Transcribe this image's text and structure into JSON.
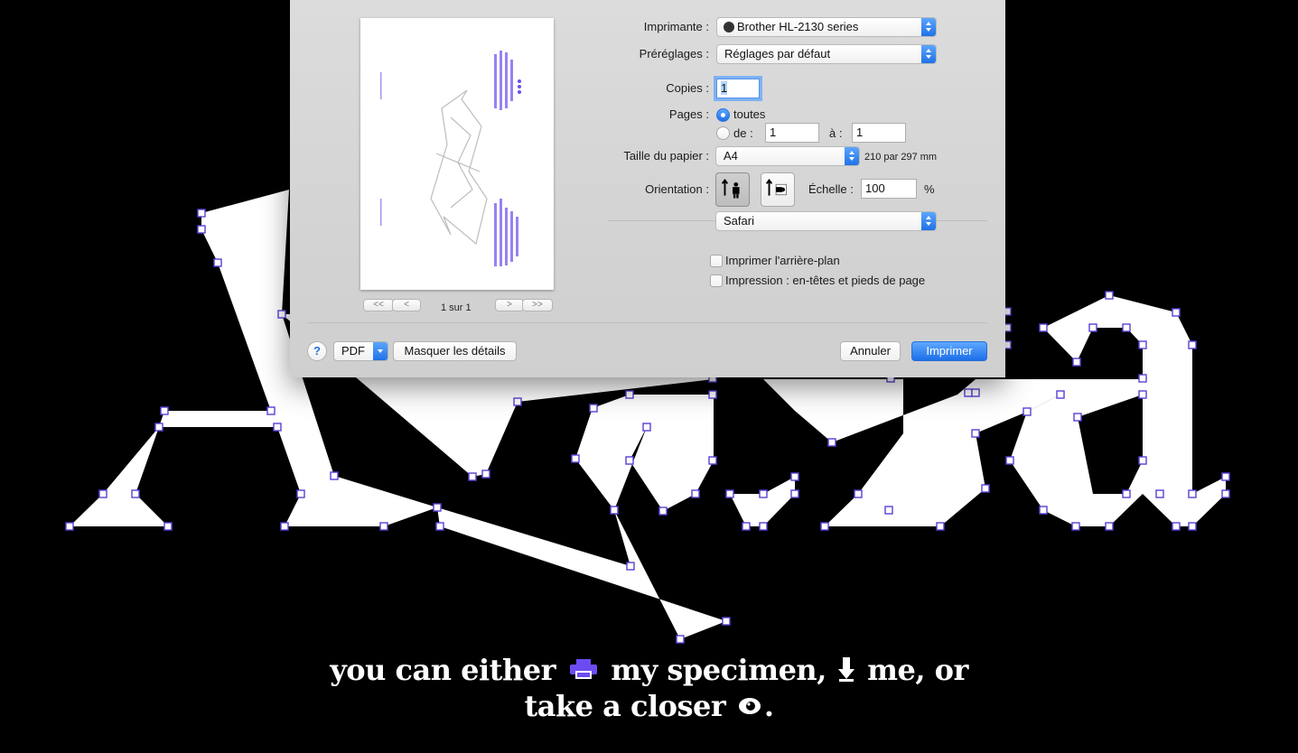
{
  "colors": {
    "accent": "#5b3fd6",
    "dialog_bg": "#d6d6d6",
    "button_blue": "#2a7ff0"
  },
  "tagline": {
    "line1_part1": "you can either",
    "line1_part2": "my specimen,",
    "line1_part3": "me, or",
    "line2_part1": "take a closer",
    "line2_end": ".",
    "icons": [
      "printer-icon",
      "download-icon",
      "eye-icon"
    ]
  },
  "print_dialog": {
    "preview": {
      "pager_label": "1 sur 1",
      "first_label": "<<",
      "prev_label": "<",
      "next_label": ">",
      "last_label": ">>"
    },
    "printer": {
      "label": "Imprimante :",
      "value": "Brother HL-2130 series"
    },
    "presets": {
      "label": "Préréglages :",
      "value": "Réglages par défaut"
    },
    "copies": {
      "label": "Copies :",
      "value": "1"
    },
    "pages": {
      "label": "Pages :",
      "all_label": "toutes",
      "from_label": "de :",
      "from_value": "1",
      "to_label": "à :",
      "to_value": "1",
      "selected": "toutes"
    },
    "paper_size": {
      "label": "Taille du papier :",
      "value": "A4",
      "dimensions": "210 par 297 mm"
    },
    "orientation": {
      "label": "Orientation :",
      "selected": "portrait"
    },
    "scale": {
      "label": "Échelle :",
      "value": "100",
      "unit": "%"
    },
    "section_popup": {
      "value": "Safari"
    },
    "options": [
      {
        "label": "Imprimer l'arrière-plan",
        "checked": false
      },
      {
        "label": "Impression : en-têtes et pieds de page",
        "checked": false
      }
    ],
    "footer": {
      "help_label": "?",
      "pdf_label": "PDF",
      "hide_details_label": "Masquer les détails",
      "cancel_label": "Annuler",
      "print_label": "Imprimer"
    }
  }
}
